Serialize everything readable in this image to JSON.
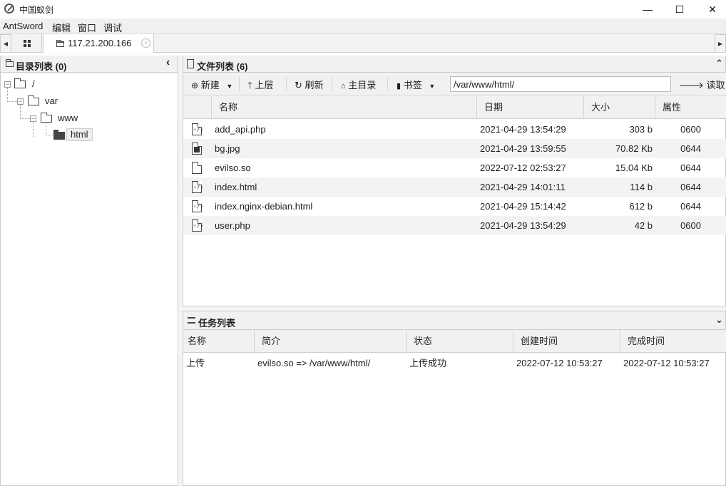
{
  "window": {
    "title": "中国蚁剑",
    "minimize": "—",
    "maximize": "☐",
    "close": "✕"
  },
  "menu": [
    "AntSword",
    "编辑",
    "窗口",
    "调试"
  ],
  "tabs": {
    "active_label": "117.21.200.166",
    "close_glyph": "×"
  },
  "left_panel": {
    "title": "目录列表 (0)",
    "collapse_glyph": "‹",
    "tree": {
      "root": "/",
      "level1": "var",
      "level2": "www",
      "level3": "html"
    }
  },
  "file_panel": {
    "title": "文件列表 (6)",
    "collapse_glyph": "⌃",
    "toolbar": {
      "new": "新建",
      "up": "上层",
      "refresh": "刷新",
      "home": "主目录",
      "bookmark": "书签",
      "path": "/var/www/html/",
      "read": "读取"
    },
    "columns": [
      "名称",
      "日期",
      "大小",
      "属性"
    ],
    "files": [
      {
        "name": "add_api.php",
        "date": "2021-04-29 13:54:29",
        "size": "303 b",
        "attr": "0600",
        "icon": "code-file-icon"
      },
      {
        "name": "bg.jpg",
        "date": "2021-04-29 13:59:55",
        "size": "70.82 Kb",
        "attr": "0644",
        "icon": "image-file-icon"
      },
      {
        "name": "evilso.so",
        "date": "2022-07-12 02:53:27",
        "size": "15.04 Kb",
        "attr": "0644",
        "icon": "blank-file-icon"
      },
      {
        "name": "index.html",
        "date": "2021-04-29 14:01:11",
        "size": "114 b",
        "attr": "0644",
        "icon": "code-file-icon"
      },
      {
        "name": "index.nginx-debian.html",
        "date": "2021-04-29 15:14:42",
        "size": "612 b",
        "attr": "0644",
        "icon": "code-file-icon"
      },
      {
        "name": "user.php",
        "date": "2021-04-29 13:54:29",
        "size": "42 b",
        "attr": "0600",
        "icon": "code-file-icon"
      }
    ]
  },
  "task_panel": {
    "title": "任务列表",
    "expand_glyph": "⌄",
    "columns": [
      "名称",
      "简介",
      "状态",
      "创建时间",
      "完成时间"
    ],
    "tasks": [
      {
        "name": "上传",
        "desc": "evilso.so => /var/www/html/",
        "status": "上传成功",
        "created": "2022-07-12 10:53:27",
        "finished": "2022-07-12 10:53:27"
      }
    ]
  },
  "colors": {
    "success": "#2a8a2a",
    "border": "#cccccc",
    "header_bg": "#f1f1f1"
  }
}
